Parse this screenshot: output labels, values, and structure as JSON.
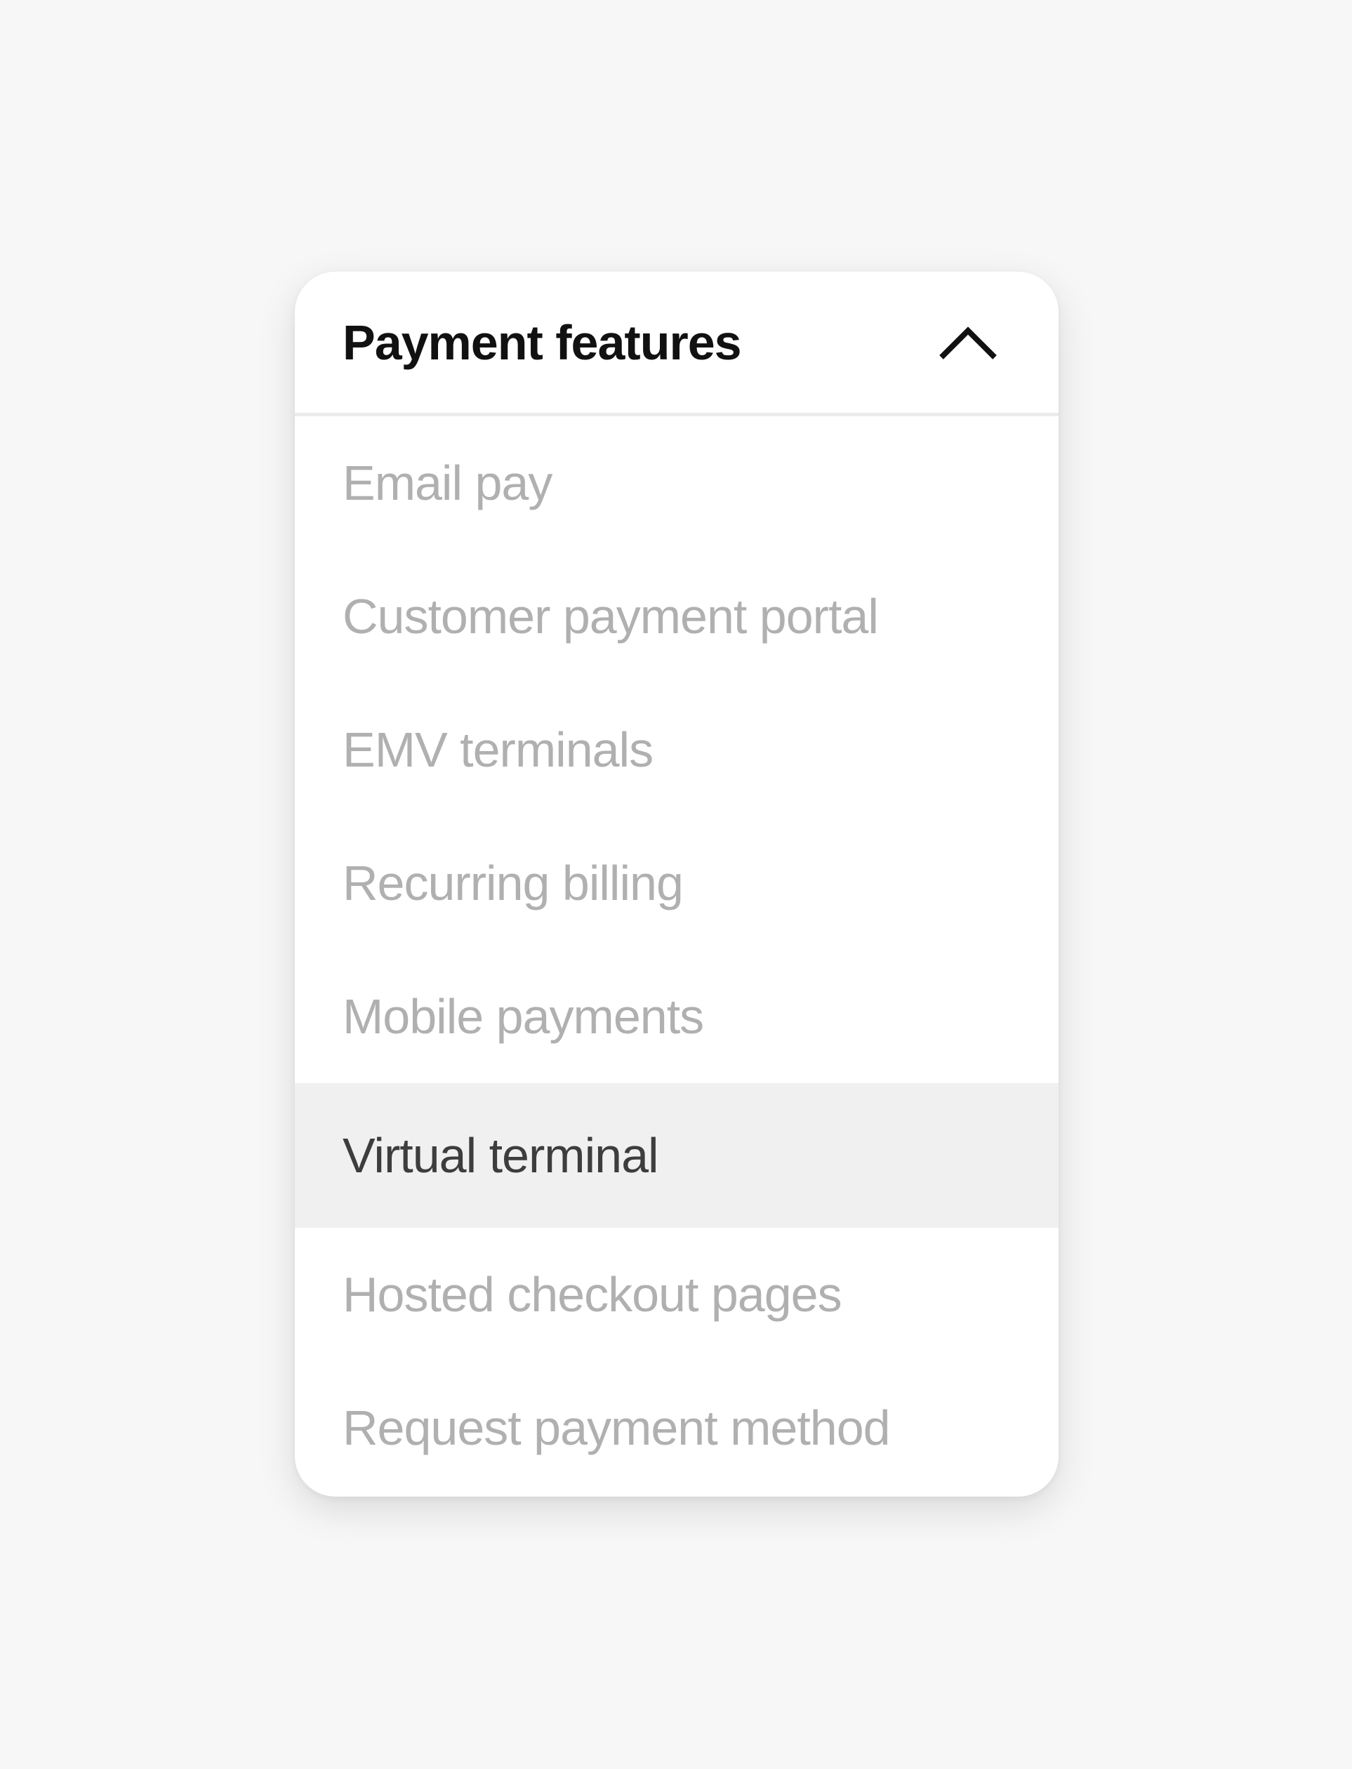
{
  "dropdown": {
    "title": "Payment features",
    "expanded": true,
    "toggle_icon": "chevron-up-icon",
    "items": [
      {
        "label": "Email pay",
        "active": false
      },
      {
        "label": "Customer payment portal",
        "active": false
      },
      {
        "label": "EMV terminals",
        "active": false
      },
      {
        "label": "Recurring billing",
        "active": false
      },
      {
        "label": "Mobile payments",
        "active": false
      },
      {
        "label": "Virtual terminal",
        "active": true
      },
      {
        "label": "Hosted checkout pages",
        "active": false
      },
      {
        "label": "Request payment method",
        "active": false
      }
    ]
  },
  "colors": {
    "page_background": "#f7f7f7",
    "panel_background": "#ffffff",
    "title_text": "#111111",
    "item_text": "#b0b0b0",
    "active_item_text": "#3d3d3d",
    "active_item_background": "#f0f0f0",
    "divider": "#ebebeb"
  }
}
